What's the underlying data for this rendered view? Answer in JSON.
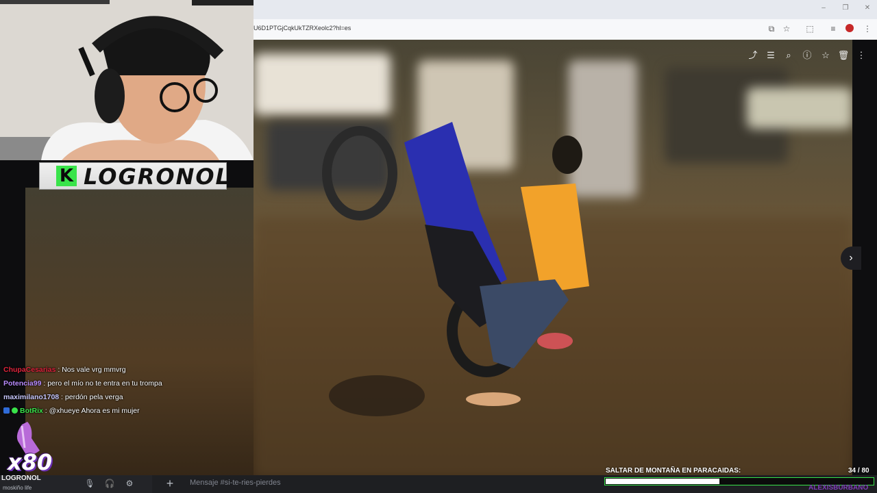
{
  "browser": {
    "url": "U6D1PTGjCqkUkTZRXeolc2?hl=es",
    "window_controls": [
      "–",
      "❐",
      "✕"
    ],
    "toolbar_icons": [
      "cast-icon",
      "bookmark-star-icon",
      "extensions-icon",
      "media-control-icon",
      "profile-icon",
      "menu-icon"
    ]
  },
  "viewer": {
    "icons": [
      "share-icon",
      "adjust-icon",
      "zoom-icon",
      "info-icon",
      "favorite-icon",
      "delete-icon",
      "more-icon"
    ],
    "next_glyph": "›"
  },
  "banner": {
    "logo_letter": "K",
    "name": "LOGRONOL"
  },
  "chat": {
    "messages": [
      {
        "user": "ChupaCesarias",
        "user_color": "#e0243c",
        "text": " : Nos vale vrg mmvrg"
      },
      {
        "user": "Potencia99",
        "user_color": "#b98cff",
        "text": " : pero el mío no te entra en tu trompa"
      },
      {
        "user": "maximilano1708",
        "user_color": "#c8c8ff",
        "text": " : perdón pela verga"
      },
      {
        "user": "BotRix",
        "user_color": "#39e34a",
        "text": " : @xhueye Ahora es mi mujer"
      }
    ]
  },
  "alert": {
    "multiplier": "x80"
  },
  "bottom": {
    "user_name": "LOGRONOL",
    "user_status": "moskiño life",
    "message_placeholder": "Mensaje #si-te-ries-pierdes",
    "add_glyph": "+"
  },
  "goal": {
    "label": "SALTAR DE MONTAÑA EN PARACAIDAS:",
    "count_text": "34 / 80",
    "current": 34,
    "total": 80,
    "bar_color": "#39e34a"
  },
  "corner": {
    "name": "ALEXISBURBANO"
  }
}
